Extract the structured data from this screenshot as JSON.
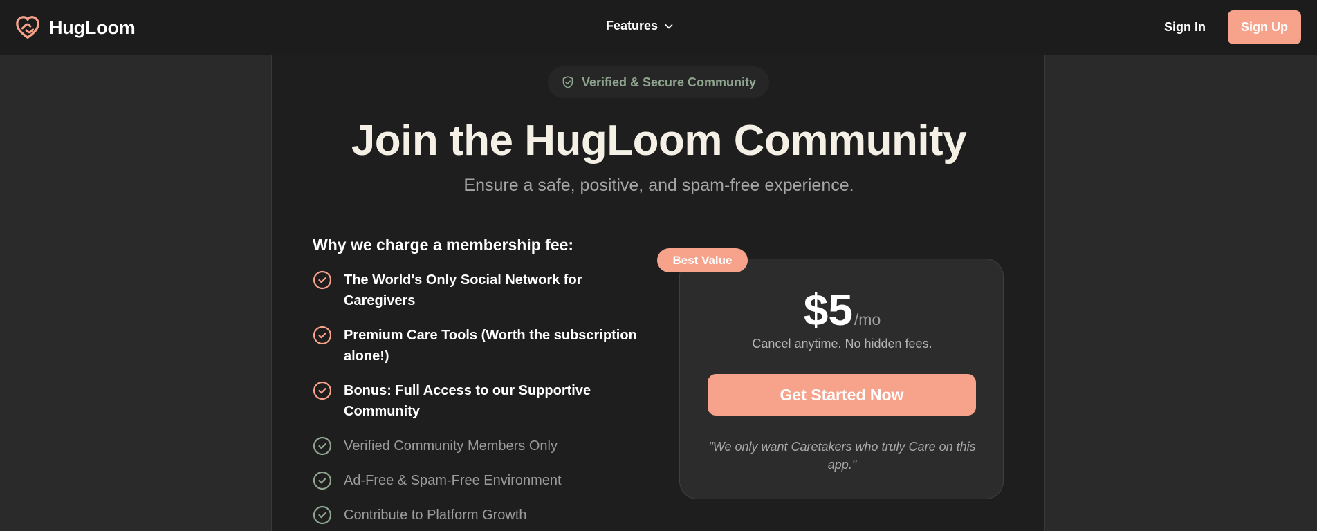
{
  "nav": {
    "brand_name": "HugLoom",
    "features_label": "Features",
    "signin_label": "Sign In",
    "signup_label": "Sign Up"
  },
  "hero": {
    "badge_label": "Verified & Secure Community",
    "title": "Join the HugLoom Community",
    "subtitle": "Ensure a safe, positive, and spam-free experience."
  },
  "benefits": {
    "heading": "Why we charge a membership fee:",
    "items": [
      {
        "label": "The World's Only Social Network for Caregivers",
        "style": "primary"
      },
      {
        "label": "Premium Care Tools (Worth the subscription alone!)",
        "style": "primary"
      },
      {
        "label": "Bonus: Full Access to our Supportive Community",
        "style": "primary"
      },
      {
        "label": "Verified Community Members Only",
        "style": "secondary"
      },
      {
        "label": "Ad-Free & Spam-Free Environment",
        "style": "secondary"
      },
      {
        "label": "Contribute to Platform Growth",
        "style": "secondary"
      }
    ]
  },
  "pricing": {
    "tag": "Best Value",
    "price": "$5",
    "period": "/mo",
    "note": "Cancel anytime. No hidden fees.",
    "cta_label": "Get Started Now",
    "quote": "\"We only want Caretakers who truly Care on this app.\""
  },
  "colors": {
    "accent": "#f7a28a",
    "primary_check": "#f7a28a",
    "secondary_check": "#8fa58f",
    "background": "#2a2a2a",
    "panel": "#1e1e1e"
  },
  "icons": {
    "brand": "heart-link-icon",
    "features": "chevron-down-icon",
    "badge": "shield-check-icon",
    "benefit": "check-circle-icon"
  }
}
